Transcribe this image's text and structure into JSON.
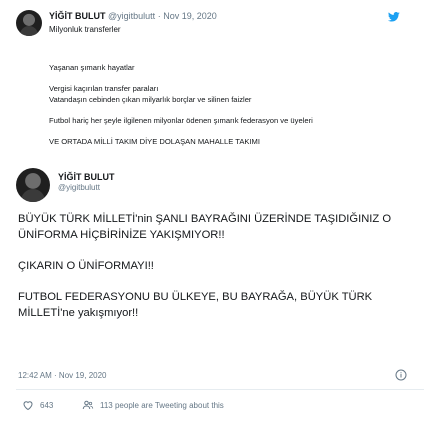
{
  "quoted": {
    "name": "YİĞİT BULUT",
    "handle": "@yigitbulutt",
    "separator": "·",
    "date": "Nov 19, 2020",
    "subtitle": "Milyonluk transferler",
    "lines": [
      "Yaşanan şımarık hayatlar",
      "Vergisi kaçırılan transfer paraları",
      "Vatandaşın cebinden çıkan milyarlık borçlar ve silinen faizler",
      "Futbol hariç her şeyle ilgilenen milyonlar ödenen şımarık federasyon ve üyeleri",
      "VE ORTADA MİLLİ TAKIM DİYE DOLAŞAN MAHALLE TAKIMI"
    ],
    "icon": "twitter-bird-icon",
    "icon_color": "#1da1f2"
  },
  "tweet": {
    "name": "YİĞİT BULUT",
    "handle": "@yigitbulutt",
    "paragraphs": [
      "BÜYÜK TÜRK MİLLETİ'nin ŞANLI BAYRAĞINI ÜZERİNDE TAŞIDIĞINIZ O ÜNİFORMA HİÇBİRİNİZE YAKIŞMIYOR!!",
      "ÇIKARIN O ÜNİFORMAYI!!",
      "FUTBOL FEDERASYONU BU ÜLKEYE, BU BAYRAĞA, BÜYÜK TÜRK MİLLETİ'ne yakışmıyor!!"
    ],
    "timestamp": "12:42 AM · Nov 19, 2020"
  },
  "actions": {
    "likes": "643",
    "retweets": "113 people are Tweeting about this"
  },
  "colors": {
    "text": "#14171a",
    "muted": "#657786",
    "divider": "#e6ecf0",
    "brand": "#1da1f2"
  }
}
